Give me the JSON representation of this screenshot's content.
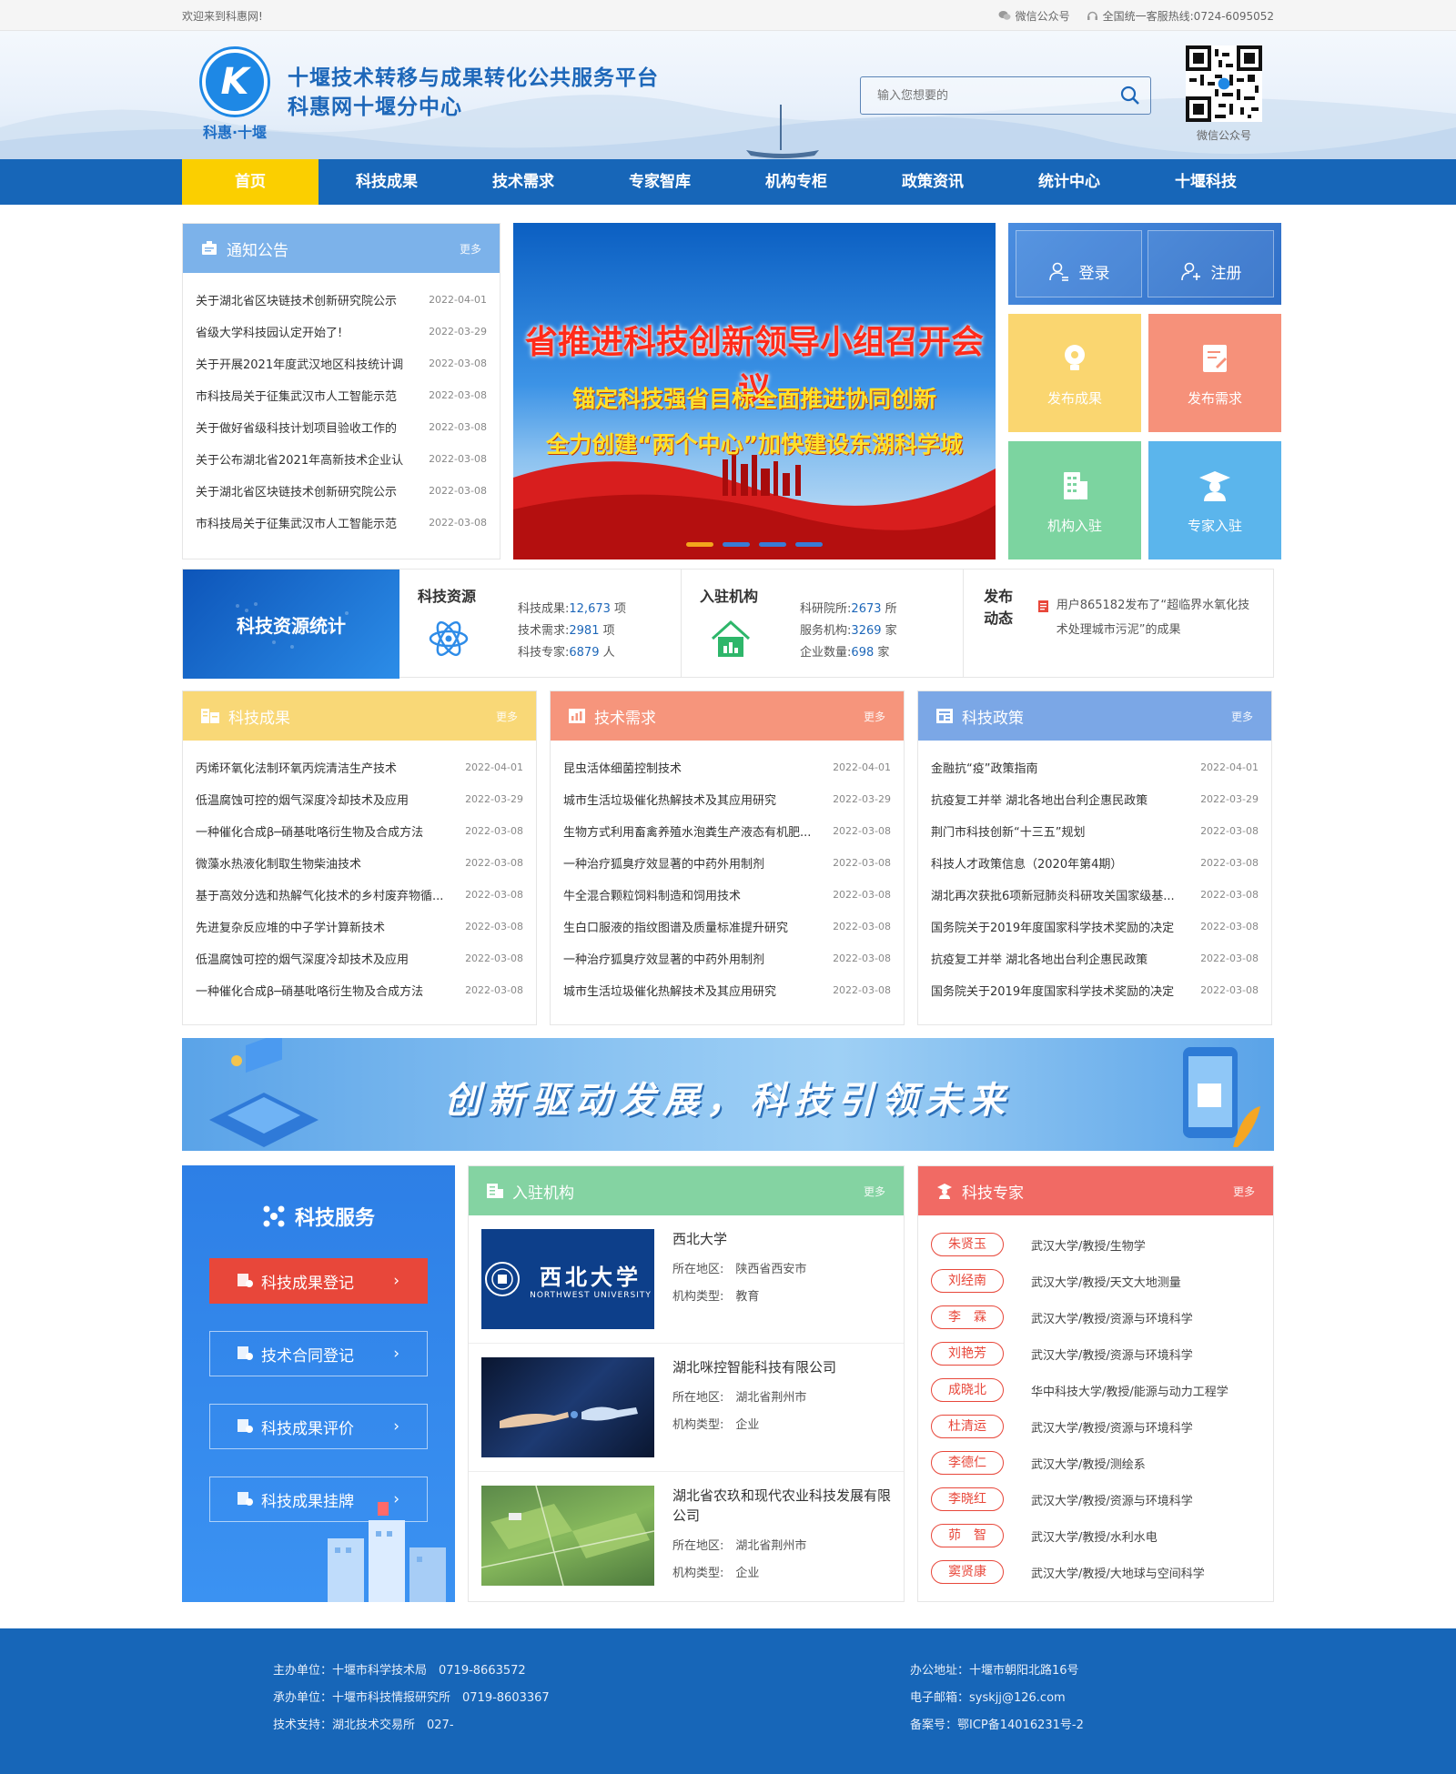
{
  "topbar": {
    "welcome": "欢迎来到科惠网!",
    "wechat": "微信公众号",
    "hotline": "全国统一客服热线:0724-6095052"
  },
  "header": {
    "logo_text": "科惠·十堰",
    "title_line1": "十堰技术转移与成果转化公共服务平台",
    "title_line2": "科惠网十堰分中心",
    "search_placeholder": "输入您想要的",
    "qr_label": "微信公众号"
  },
  "nav": [
    "首页",
    "科技成果",
    "技术需求",
    "专家智库",
    "机构专柜",
    "政策资讯",
    "统计中心",
    "十堰科技"
  ],
  "notice": {
    "title": "通知公告",
    "more": "更多",
    "items": [
      {
        "t": "关于湖北省区块链技术创新研究院公示",
        "d": "2022-04-01"
      },
      {
        "t": "省级大学科技园认定开始了!",
        "d": "2022-03-29"
      },
      {
        "t": "关于开展2021年度武汉地区科技统计调",
        "d": "2022-03-08"
      },
      {
        "t": "市科技局关于征集武汉市人工智能示范",
        "d": "2022-03-08"
      },
      {
        "t": "关于做好省级科技计划项目验收工作的",
        "d": "2022-03-08"
      },
      {
        "t": "关于公布湖北省2021年高新技术企业认",
        "d": "2022-03-08"
      },
      {
        "t": "关于湖北省区块链技术创新研究院公示",
        "d": "2022-03-08"
      },
      {
        "t": "市科技局关于征集武汉市人工智能示范",
        "d": "2022-03-08"
      }
    ]
  },
  "banner": {
    "line1": "省推进科技创新领导小组召开会议",
    "line2": "锚定科技强省目标全面推进协同创新",
    "line3": "全力创建“两个中心”加快建设东湖科学城"
  },
  "quick": {
    "login": "登录",
    "register": "注册",
    "publish_result": "发布成果",
    "publish_demand": "发布需求",
    "org_join": "机构入驻",
    "expert_join": "专家入驻"
  },
  "stats": {
    "banner": "科技资源统计",
    "resource": {
      "title": "科技资源",
      "l1": "科技成果:",
      "v1": "12,673",
      "u1": "项",
      "l2": "技术需求:",
      "v2": "2981",
      "u2": "项",
      "l3": "科技专家:",
      "v3": "6879",
      "u3": "人"
    },
    "org": {
      "title": "入驻机构",
      "l1": "科研院所:",
      "v1": "2673",
      "u1": "所",
      "l2": "服务机构:",
      "v2": "3269",
      "u2": "家",
      "l3": "企业数量:",
      "v3": "698",
      "u3": "家"
    },
    "dynamic": {
      "title": "发布动态",
      "text": "用户865182发布了“超临界水氧化技术处理城市污泥”的成果"
    }
  },
  "achievements": {
    "title": "科技成果",
    "more": "更多",
    "items": [
      {
        "t": "丙烯环氧化法制环氧丙烷清洁生产技术",
        "d": "2022-04-01"
      },
      {
        "t": "低温腐蚀可控的烟气深度冷却技术及应用",
        "d": "2022-03-29"
      },
      {
        "t": "一种催化合成β─硝基吡咯衍生物及合成方法",
        "d": "2022-03-08"
      },
      {
        "t": "微藻水热液化制取生物柴油技术",
        "d": "2022-03-08"
      },
      {
        "t": "基于高效分选和热解气化技术的乡村废弃物循...",
        "d": "2022-03-08"
      },
      {
        "t": "先进复杂反应堆的中子学计算新技术",
        "d": "2022-03-08"
      },
      {
        "t": "低温腐蚀可控的烟气深度冷却技术及应用",
        "d": "2022-03-08"
      },
      {
        "t": "一种催化合成β─硝基吡咯衍生物及合成方法",
        "d": "2022-03-08"
      }
    ]
  },
  "demands": {
    "title": "技术需求",
    "more": "更多",
    "items": [
      {
        "t": "昆虫活体细菌控制技术",
        "d": "2022-04-01"
      },
      {
        "t": "城市生活垃圾催化热解技术及其应用研究",
        "d": "2022-03-29"
      },
      {
        "t": "生物方式利用畜禽养殖水泡粪生产液态有机肥...",
        "d": "2022-03-08"
      },
      {
        "t": "一种治疗狐臭疗效显著的中药外用制剂",
        "d": "2022-03-08"
      },
      {
        "t": "牛全混合颗粒饲料制造和饲用技术",
        "d": "2022-03-08"
      },
      {
        "t": "生白口服液的指纹图谱及质量标准提升研究",
        "d": "2022-03-08"
      },
      {
        "t": "一种治疗狐臭疗效显著的中药外用制剂",
        "d": "2022-03-08"
      },
      {
        "t": "城市生活垃圾催化热解技术及其应用研究",
        "d": "2022-03-08"
      }
    ]
  },
  "policies": {
    "title": "科技政策",
    "more": "更多",
    "items": [
      {
        "t": "金融抗“疫”政策指南",
        "d": "2022-04-01"
      },
      {
        "t": "抗疫复工并举 湖北各地出台利企惠民政策",
        "d": "2022-03-29"
      },
      {
        "t": "荆门市科技创新“十三五”规划",
        "d": "2022-03-08"
      },
      {
        "t": "科技人才政策信息（2020年第4期）",
        "d": "2022-03-08"
      },
      {
        "t": "湖北再次获批6项新冠肺炎科研攻关国家级基...",
        "d": "2022-03-08"
      },
      {
        "t": "国务院关于2019年度国家科学技术奖励的决定",
        "d": "2022-03-08"
      },
      {
        "t": "抗疫复工并举 湖北各地出台利企惠民政策",
        "d": "2022-03-08"
      },
      {
        "t": "国务院关于2019年度国家科学技术奖励的决定",
        "d": "2022-03-08"
      }
    ]
  },
  "ad": {
    "slogan": "创新驱动发展，科技引领未来"
  },
  "services": {
    "title": "科技服务",
    "items": [
      "科技成果登记",
      "技术合同登记",
      "科技成果评价",
      "科技成果挂牌"
    ]
  },
  "orgs": {
    "title": "入驻机构",
    "more": "更多",
    "loc_label": "所在地区:",
    "type_label": "机构类型:",
    "items": [
      {
        "name": "西北大学",
        "loc": "陕西省西安市",
        "type": "教育",
        "img_text": "西北大学",
        "img_sub": "NORTHWEST UNIVERSITY"
      },
      {
        "name": "湖北咪控智能科技有限公司",
        "loc": "湖北省荆州市",
        "type": "企业"
      },
      {
        "name": "湖北省农玖和现代农业科技发展有限公司",
        "loc": "湖北省荆州市",
        "type": "企业"
      }
    ]
  },
  "experts": {
    "title": "科技专家",
    "more": "更多",
    "items": [
      {
        "n": "朱贤玉",
        "d": "武汉大学/教授/生物学"
      },
      {
        "n": "刘经南",
        "d": "武汉大学/教授/天文大地测量"
      },
      {
        "n": "李　霖",
        "d": "武汉大学/教授/资源与环境科学"
      },
      {
        "n": "刘艳芳",
        "d": "武汉大学/教授/资源与环境科学"
      },
      {
        "n": "成晓北",
        "d": "华中科技大学/教授/能源与动力工程学"
      },
      {
        "n": "杜清运",
        "d": "武汉大学/教授/资源与环境科学"
      },
      {
        "n": "李德仁",
        "d": "武汉大学/教授/测绘系"
      },
      {
        "n": "李晓红",
        "d": "武汉大学/教授/资源与环境科学"
      },
      {
        "n": "茆　智",
        "d": "武汉大学/教授/水利水电"
      },
      {
        "n": "窦贤康",
        "d": "武汉大学/教授/大地球与空间科学"
      }
    ]
  },
  "footer": {
    "host": "主办单位：十堰市科学技术局　0719-8663572",
    "organizer": "承办单位：十堰市科技情报研究所　0719-8603367",
    "support": "技术支持：湖北技术交易所　027-",
    "address": "办公地址：十堰市朝阳北路16号",
    "email": "电子邮箱：syskjj@126.com",
    "icp": "备案号：鄂ICP备14016231号-2"
  }
}
